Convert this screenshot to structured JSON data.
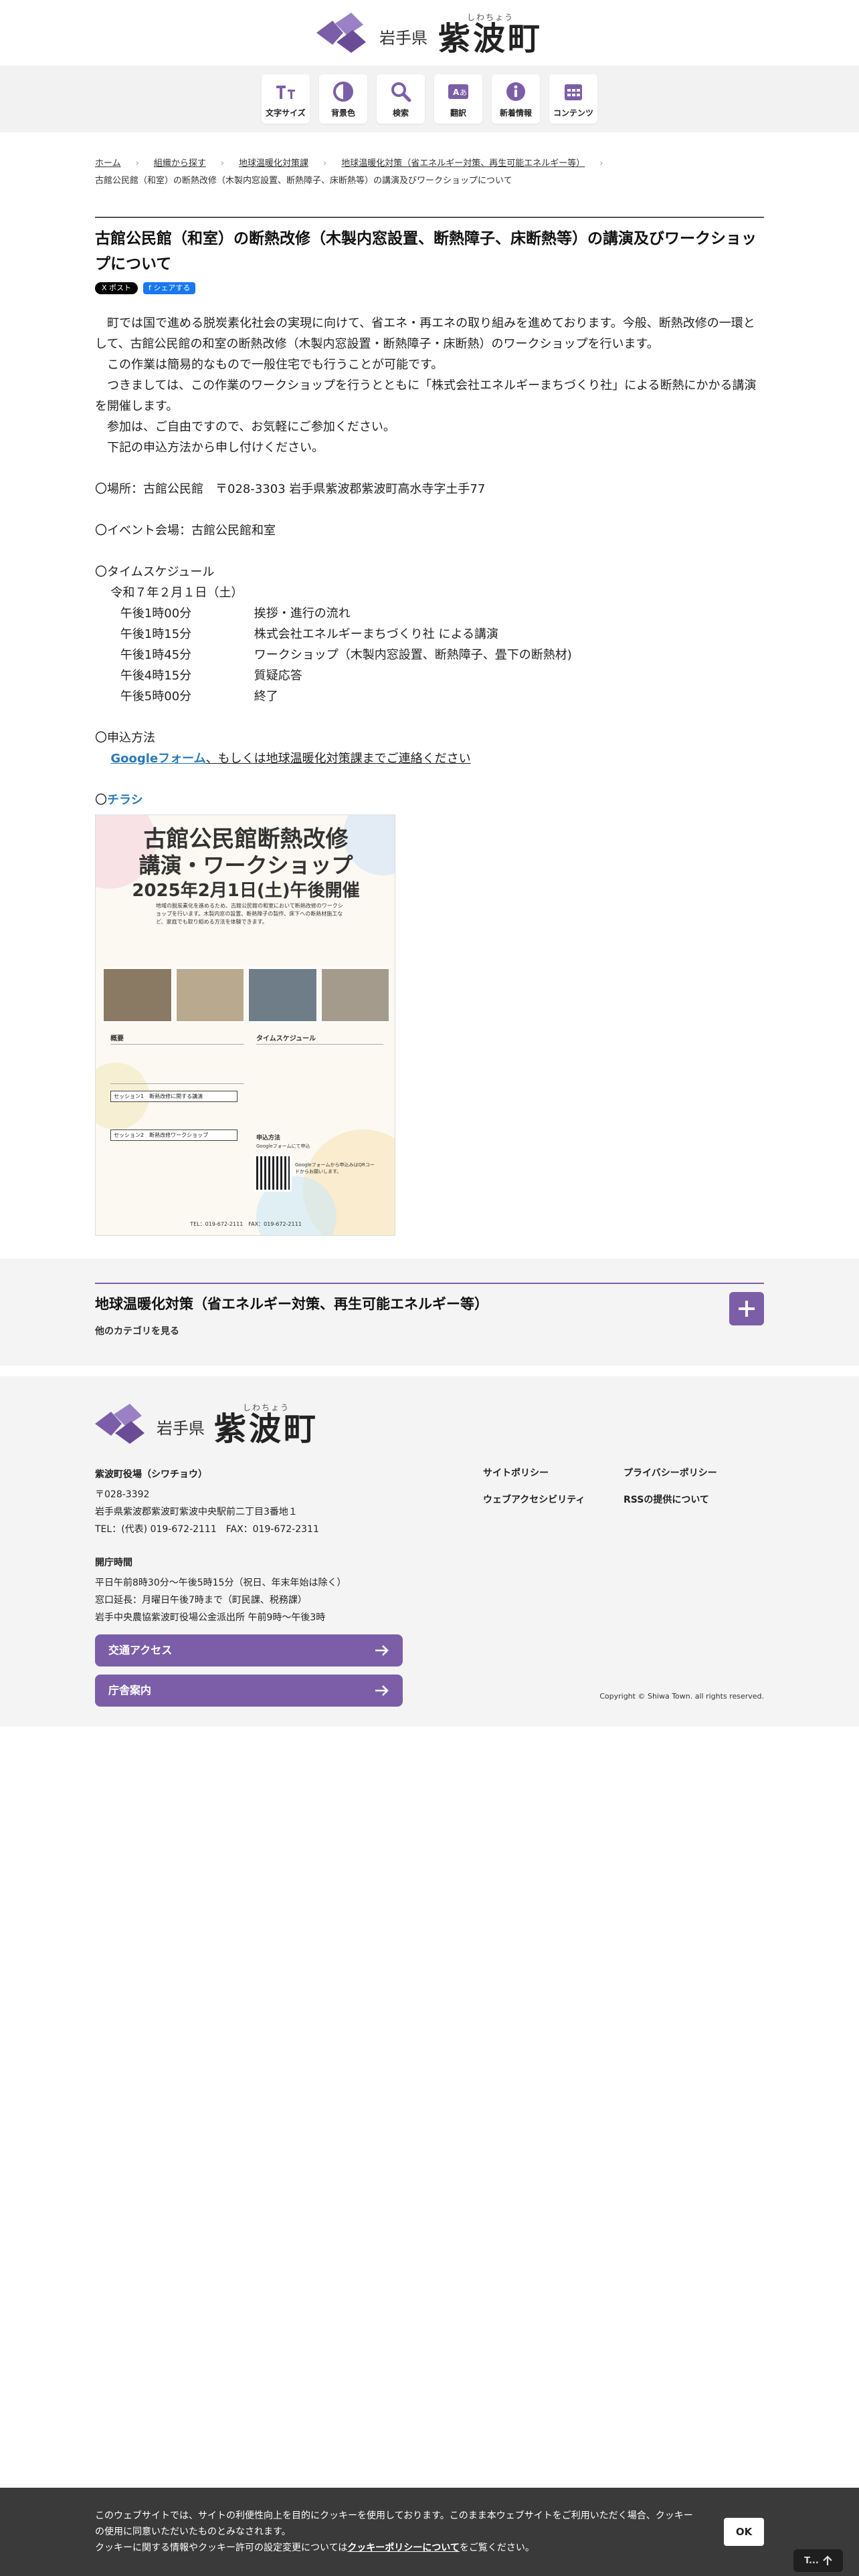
{
  "header": {
    "pref": "岩手県",
    "town": "紫波町",
    "ruby": "しわちょう"
  },
  "toolbar": [
    {
      "label": "文字サイズ",
      "icon": "text-size-icon"
    },
    {
      "label": "背景色",
      "icon": "contrast-icon"
    },
    {
      "label": "検索",
      "icon": "search-icon"
    },
    {
      "label": "翻訳",
      "icon": "translate-icon"
    },
    {
      "label": "新着情報",
      "icon": "info-icon"
    },
    {
      "label": "コンテンツ",
      "icon": "calendar-icon"
    }
  ],
  "breadcrumb": [
    "ホーム",
    "組織から探す",
    "地球温暖化対策課",
    "地球温暖化対策（省エネルギー対策、再生可能エネルギー等）",
    "古館公民館（和室）の断熱改修（木製内窓設置、断熱障子、床断熱等）の講演及びワークショップについて"
  ],
  "article": {
    "title": "古館公民館（和室）の断熱改修（木製内窓設置、断熱障子、床断熱等）の講演及びワークショップについて",
    "share_x": "X ポスト",
    "share_fb": "f シェアする",
    "intro": [
      "町では国で進める脱炭素化社会の実現に向けて、省エネ・再エネの取り組みを進めております。今般、断熱改修の一環として、古館公民館の和室の断熱改修（木製内窓設置・断熱障子・床断熱）のワークショップを行います。",
      "この作業は簡易的なもので一般住宅でも行うことが可能です。",
      "つきましては、この作業のワークショップを行うとともに「株式会社エネルギーまちづくり社」による断熱にかかる講演を開催します。",
      "参加は、ご自由ですので、お気軽にご参加ください。",
      "下記の申込方法から申し付けください。"
    ],
    "place": "〇場所：古館公民館　〒028-3303 岩手県紫波郡紫波町高水寺字土手77",
    "venue": "〇イベント会場：古館公民館和室",
    "schedule_title": "〇タイムスケジュール",
    "schedule_date": "令和７年２月１日（土）",
    "schedule": [
      {
        "time": "午後1時00分",
        "item": "挨拶・進行の流れ"
      },
      {
        "time": "午後1時15分",
        "item": "株式会社エネルギーまちづくり社 による講演"
      },
      {
        "time": "午後1時45分",
        "item": "ワークショップ（木製内窓設置、断熱障子、畳下の断熱材)"
      },
      {
        "time": "午後4時15分",
        "item": "質疑応答"
      },
      {
        "time": "午後5時00分",
        "item": "終了"
      }
    ],
    "apply_title": "〇申込方法",
    "apply_link": "Googleフォーム",
    "apply_rest": "、もしくは地球温暖化対策課までご連絡ください",
    "flyer_prefix": "〇",
    "flyer_link": "チラシ"
  },
  "flyer": {
    "title1": "古館公民館断熱改修",
    "title2": "講演・ワークショップ",
    "date": "2025年2月1日(土)午後開催",
    "lead": "地域の脱炭素化を進めるため、古館公民館の和室において断熱改修のワークショップを行います。木製内窓の設置、断熱障子の製作、床下への断熱材施工など、家庭でも取り組める方法を体験できます。",
    "overview": "概要",
    "schedule": "タイムスケジュール",
    "session1": "セッション1　断熱改修に関する講演",
    "session2": "セッション2　断熱改修ワークショップ",
    "apply": "申込方法",
    "apply_note": "Googleフォームにて申込",
    "qr_note": "Googleフォームから申込みはQRコードからお願いします。",
    "footer": "TEL：019-672-2111　FAX：019-672-2111"
  },
  "category": {
    "title": "地球温暖化対策（省エネルギー対策、再生可能エネルギー等）",
    "sub": "他のカテゴリを見る"
  },
  "footer": {
    "office": "紫波町役場（シワチョウ）",
    "zip": "〒028-3392",
    "address": "岩手県紫波郡紫波町紫波中央駅前二丁目3番地１",
    "tel": "TEL：(代表) 019-672-2111　FAX：019-672-2311",
    "hours_title": "開庁時間",
    "hours": [
      "平日午前8時30分～午後5時15分（祝日、年末年始は除く）",
      "窓口延長：月曜日午後7時まで（町民課、税務課）",
      "岩手中央農協紫波町役場公金派出所 午前9時～午後3時"
    ],
    "btn_access": "交通アクセス",
    "btn_guide": "庁舎案内",
    "links": [
      "サイトポリシー",
      "プライバシーポリシー",
      "ウェブアクセシビリティ",
      "RSSの提供について"
    ],
    "copyright": "Copyright © Shiwa Town. all rights reserved."
  },
  "cookie": {
    "line1": "このウェブサイトでは、サイトの利便性向上を目的にクッキーを使用しております。このまま本ウェブサイトをご利用いただく場合、クッキーの使用に同意いただいたものとみなされます。",
    "line2_pre": "クッキーに関する情報やクッキー許可の設定変更については",
    "line2_link": "クッキーポリシーについて",
    "line2_post": "をご覧ください。",
    "ok": "OK",
    "top": "T..."
  },
  "colors": {
    "brand": "#7b5ea7",
    "link": "#2a7ab8",
    "cookie_bg": "#3a3a3a"
  }
}
